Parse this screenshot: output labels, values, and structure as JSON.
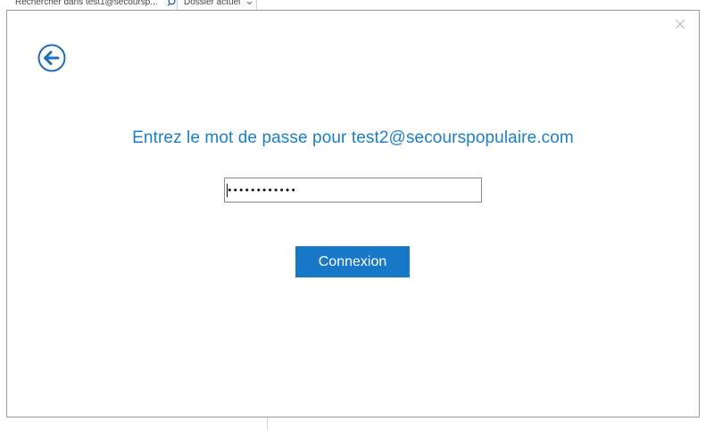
{
  "background": {
    "search": {
      "placeholder": "Rechercher dans test1@secoursp...",
      "icon": "search-icon"
    },
    "scope": {
      "label": "Dossier actuel",
      "icon": "chevron-down-icon"
    }
  },
  "dialog": {
    "close_icon": "close-icon",
    "back_icon": "back-arrow-icon",
    "title": "Entrez le mot de passe pour test2@secourspopulaire.com",
    "password": {
      "value": "••••••••••••"
    },
    "signin_label": "Connexion"
  },
  "colors": {
    "accent": "#1a7fc8",
    "button": "#1878c7",
    "dialog_border": "#9a9a9a"
  }
}
